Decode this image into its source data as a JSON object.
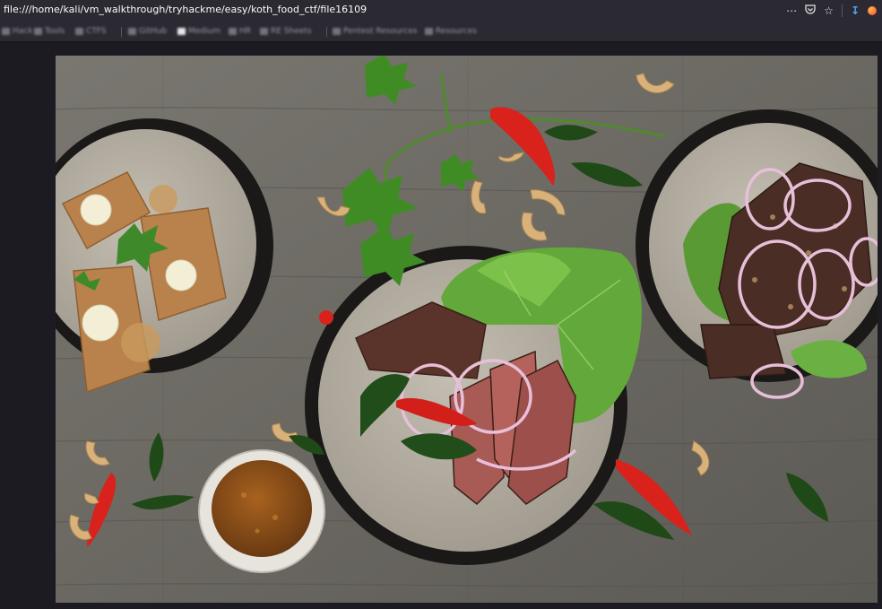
{
  "browser": {
    "url": "file:///home/kali/vm_walkthrough/tryhackme/easy/koth_food_ctf/file16109",
    "url_icons": [
      "more-icon",
      "pocket-icon",
      "bookmark-star-icon",
      "download-icon",
      "firefox-icon"
    ]
  },
  "bookmarks": {
    "items": [
      {
        "label": "Hack"
      },
      {
        "label": "Tools"
      },
      {
        "label": "CTFS"
      },
      {
        "label": "GitHub"
      },
      {
        "label": "Medium"
      },
      {
        "label": "HR"
      },
      {
        "label": "RE Sheets"
      },
      {
        "label": "Pentest Resources"
      },
      {
        "label": "Resources"
      }
    ]
  },
  "viewer": {
    "image_alt": "file16109"
  },
  "colors": {
    "chrome": "#2b2a33",
    "background": "#1c1b22",
    "table": "#6f6c66"
  }
}
